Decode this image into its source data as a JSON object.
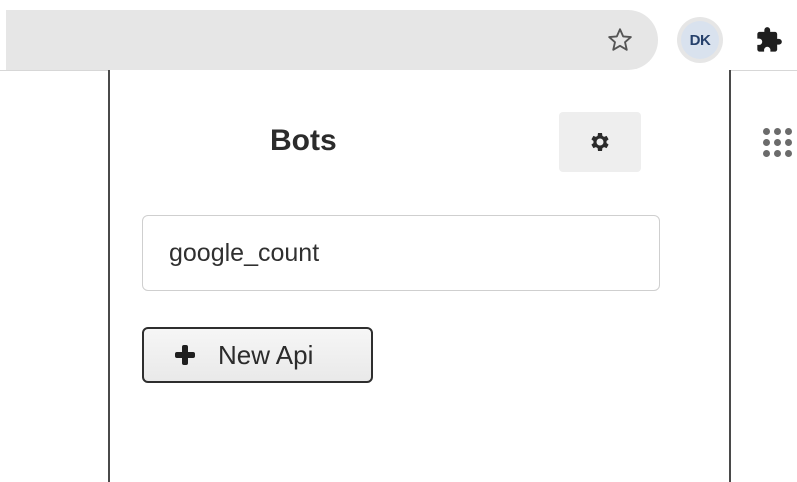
{
  "browser": {
    "bookmark_icon": "star-outline-icon",
    "profile": {
      "initials": "DK",
      "avatar_bg": "#d9e2ee",
      "initials_color": "#25406b"
    },
    "extensions_icon": "puzzle-piece-icon"
  },
  "popup": {
    "title": "Bots",
    "settings_icon": "gear-icon",
    "bot_field": {
      "value": "google_count"
    },
    "new_api_button": {
      "icon": "plus-icon",
      "label": "New Api"
    }
  },
  "page": {
    "apps_icon": "apps-grid-icon"
  },
  "colors": {
    "omnibox_bg": "#e6e6e6",
    "popup_border": "#4a4a4a",
    "settings_bg": "#eeeeee",
    "text": "#2b2b2b"
  }
}
